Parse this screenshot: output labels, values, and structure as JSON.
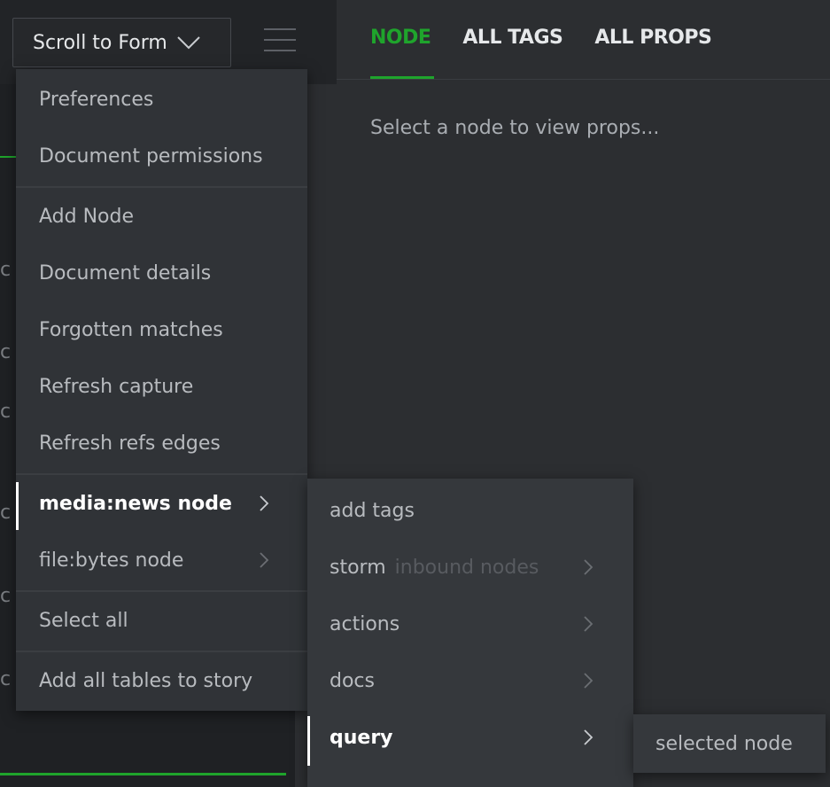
{
  "toolbar": {
    "scroll_label": "Scroll to Form",
    "menu_icon": "hamburger-icon"
  },
  "tabs": [
    {
      "label": "NODE",
      "active": true
    },
    {
      "label": "ALL TAGS",
      "active": false
    },
    {
      "label": "ALL PROPS",
      "active": false
    }
  ],
  "props_panel": {
    "message": "Select a node to view props..."
  },
  "main_menu": {
    "items": [
      "Preferences",
      "Document permissions",
      "Add Node",
      "Document details",
      "Forgotten matches",
      "Refresh capture",
      "Refresh refs edges",
      "media:news node",
      "file:bytes node",
      "Select all",
      "Add all tables to story"
    ]
  },
  "submenu": {
    "items": [
      "add tags",
      "storm",
      "actions",
      "docs",
      "query"
    ],
    "storm_suffix": "inbound nodes"
  },
  "submenu2": {
    "item": "selected node"
  },
  "left_panel": {
    "stub_char": "c"
  },
  "colors": {
    "accent": "#1fa42c",
    "menu_bg": "#303337",
    "submenu_bg": "#35383c"
  }
}
